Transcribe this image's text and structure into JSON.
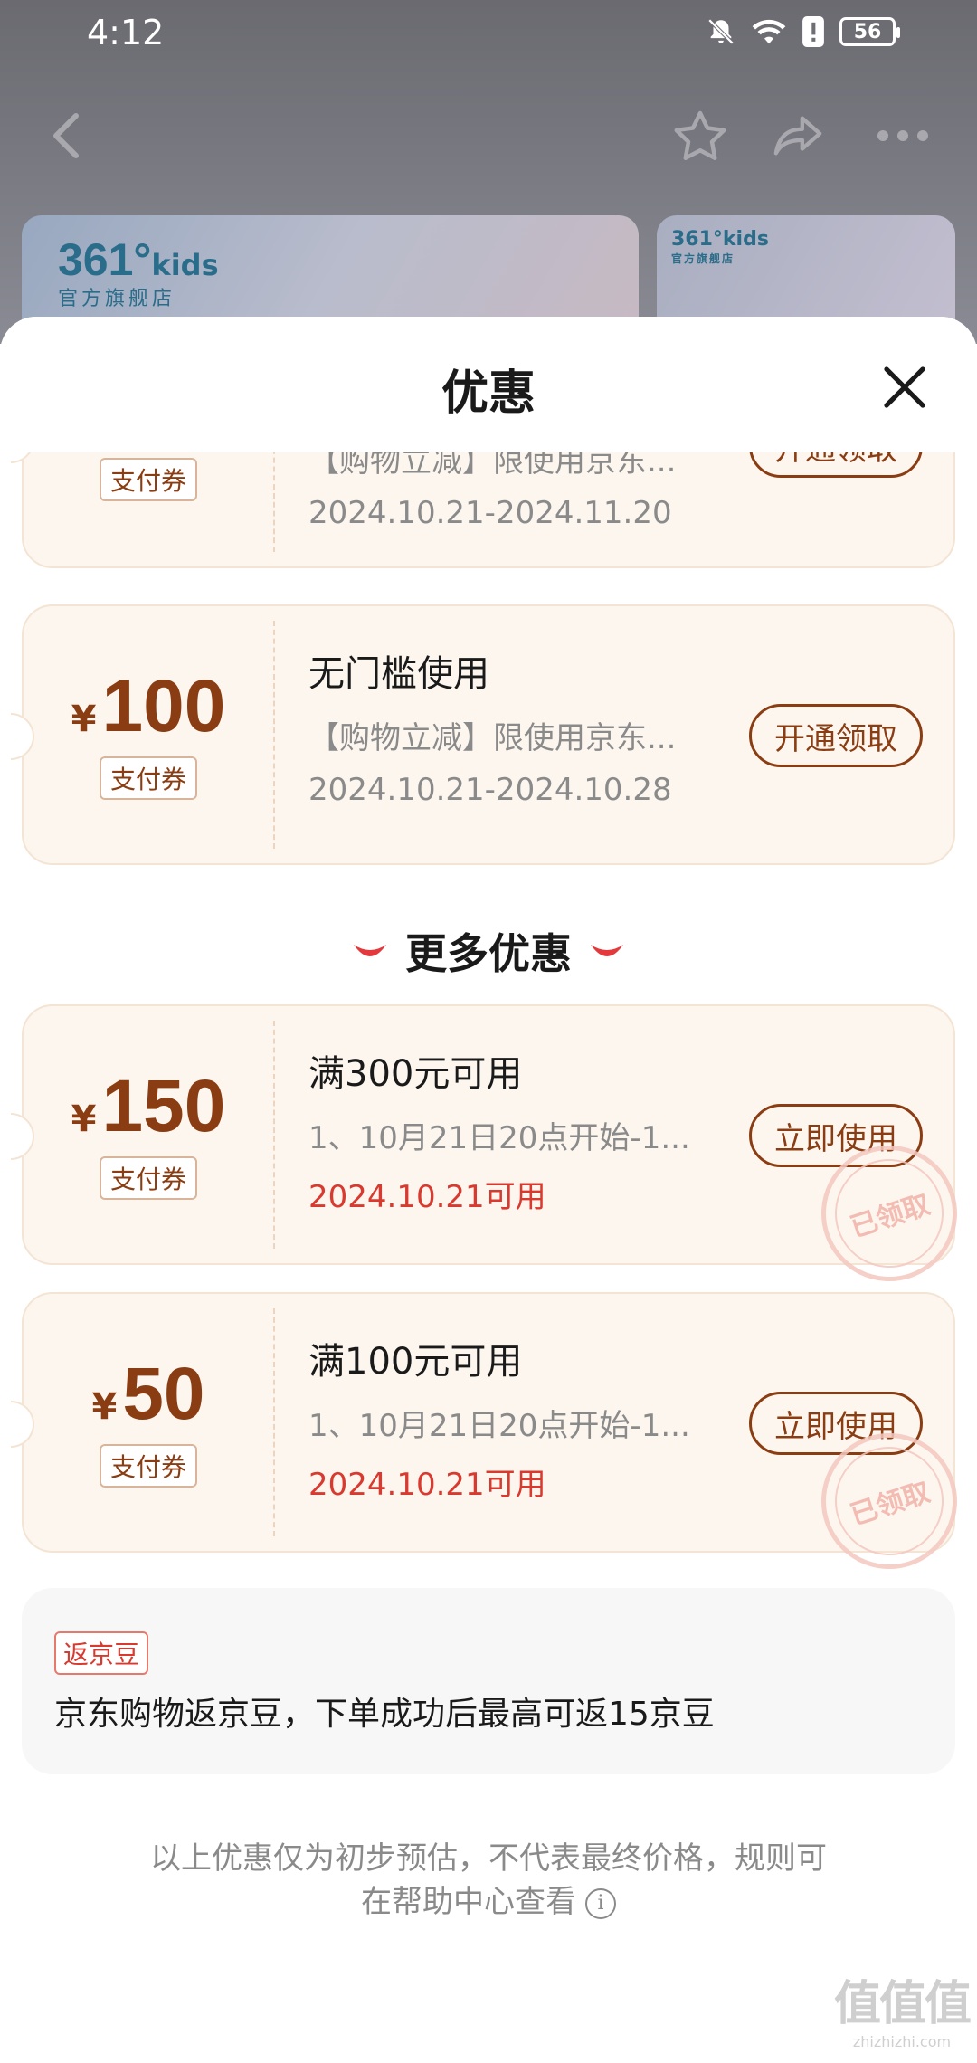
{
  "status_bar": {
    "time": "4:12",
    "battery": "56",
    "icons": [
      "bell-off-icon",
      "wifi-icon",
      "alert-icon",
      "battery-icon"
    ]
  },
  "nav": {
    "icons": [
      "back-icon",
      "star-icon",
      "share-icon",
      "more-icon"
    ]
  },
  "banners": [
    {
      "logo": "361°",
      "logo_suffix": "kids",
      "sub": "官方旗舰店"
    },
    {
      "logo": "361°kids",
      "sub": "官方旗舰店"
    }
  ],
  "sheet": {
    "title": "优惠",
    "close_icon": "close-icon"
  },
  "coupons": [
    {
      "currency": "¥",
      "amount": "",
      "tag": "支付券",
      "title": "",
      "desc": "【购物立减】限使用京东...",
      "date": "2024.10.21-2024.11.20",
      "button": "开通领取",
      "claimed": false
    },
    {
      "currency": "¥",
      "amount": "100",
      "tag": "支付券",
      "title": "无门槛使用",
      "desc": "【购物立减】限使用京东...",
      "date": "2024.10.21-2024.10.28",
      "button": "开通领取",
      "claimed": false
    }
  ],
  "more_section": {
    "title": "更多优惠",
    "coupons": [
      {
        "currency": "¥",
        "amount": "150",
        "tag": "支付券",
        "title": "满300元可用",
        "desc": "1、10月21日20点开始-1...",
        "date": "2024.10.21可用",
        "button": "立即使用",
        "stamp": "已领取"
      },
      {
        "currency": "¥",
        "amount": "50",
        "tag": "支付券",
        "title": "满100元可用",
        "desc": "1、10月21日20点开始-1...",
        "date": "2024.10.21可用",
        "button": "立即使用",
        "stamp": "已领取"
      }
    ]
  },
  "jd_beans": {
    "tag": "返京豆",
    "text": "京东购物返京豆，下单成功后最高可返15京豆"
  },
  "disclaimer": {
    "line1": "以上优惠仅为初步预估，不代表最终价格，规则可",
    "line2": "在帮助中心查看"
  },
  "watermark": {
    "big": "值值值",
    "small": "zhizhizhi.com"
  },
  "colors": {
    "brown": "#8a3d12",
    "red": "#d93a2f",
    "coupon_bg": "#fdf6ef"
  }
}
